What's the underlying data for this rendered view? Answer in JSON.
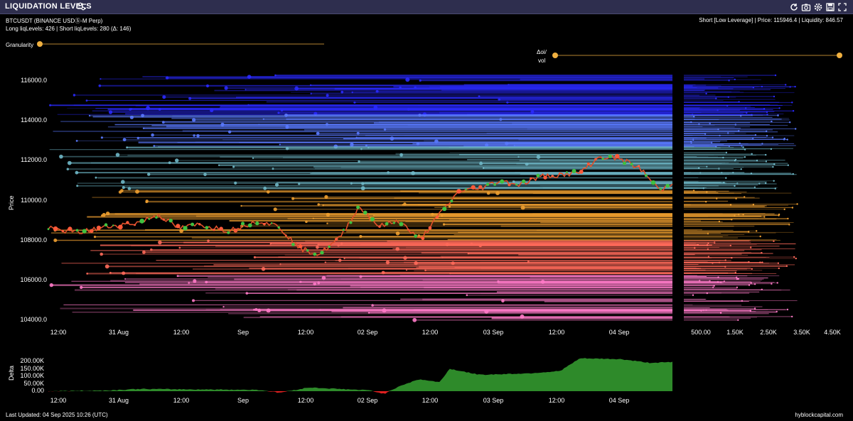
{
  "window": {
    "title": "LIQUIDATION LEVELS",
    "icons": [
      "refresh-icon",
      "camera-icon",
      "settings-icon",
      "save-icon",
      "expand-icon",
      "close-icon"
    ]
  },
  "header": {
    "symbol": "BTCUSDT (BINANCE USDⓈ-M Perp)",
    "levels_summary": "Long liqLevels: 426 | Short liqLevels: 280 (Δ: 146)",
    "selection_info": "Short [Low Leverage] | Price: 115946.4 | Liquidity: 846.57"
  },
  "controls": {
    "granularity_label": "Granularity",
    "granularity_value": 0.0,
    "delta_label_top": "Δoi/",
    "delta_label_bottom": "vol",
    "delta_value": 0.0,
    "accent": "#f0b040"
  },
  "footer": {
    "last_updated": "Last Updated: 04 Sep 2025 10:26 (UTC)",
    "brand": "hyblockcapital.com"
  },
  "chart_data": [
    {
      "type": "line",
      "title": "",
      "ylabel": "Price",
      "y_ticks": [
        "116000.0",
        "114000.0",
        "112000.0",
        "110000.0",
        "108000.0",
        "106000.0",
        "104000.0"
      ],
      "ylim": [
        103700,
        117000
      ],
      "x_ticks": [
        "12:00",
        "31 Aug",
        "12:00",
        "Sep",
        "12:00",
        "02 Sep",
        "12:00",
        "03 Sep",
        "12:00",
        "04 Sep"
      ],
      "x_start": "2025-08-30T06:00",
      "x_end": "2025-09-04T10:26",
      "price_series": [
        {
          "t": "2025-08-30T06:00",
          "p": 108600
        },
        {
          "t": "2025-08-30T12:00",
          "p": 108400
        },
        {
          "t": "2025-08-30T18:00",
          "p": 108700
        },
        {
          "t": "2025-08-31T00:00",
          "p": 108900
        },
        {
          "t": "2025-08-31T04:00",
          "p": 109300
        },
        {
          "t": "2025-08-31T08:00",
          "p": 108600
        },
        {
          "t": "2025-08-31T12:00",
          "p": 108800
        },
        {
          "t": "2025-08-31T18:00",
          "p": 108500
        },
        {
          "t": "2025-09-01T00:00",
          "p": 109000
        },
        {
          "t": "2025-09-01T04:00",
          "p": 108700
        },
        {
          "t": "2025-09-01T08:00",
          "p": 107600
        },
        {
          "t": "2025-09-01T12:00",
          "p": 107300
        },
        {
          "t": "2025-09-01T16:00",
          "p": 108100
        },
        {
          "t": "2025-09-01T20:00",
          "p": 109700
        },
        {
          "t": "2025-09-02T00:00",
          "p": 108700
        },
        {
          "t": "2025-09-02T04:00",
          "p": 109000
        },
        {
          "t": "2025-09-02T08:00",
          "p": 108000
        },
        {
          "t": "2025-09-02T12:00",
          "p": 109300
        },
        {
          "t": "2025-09-02T16:00",
          "p": 110500
        },
        {
          "t": "2025-09-02T20:00",
          "p": 110600
        },
        {
          "t": "2025-09-03T00:00",
          "p": 111000
        },
        {
          "t": "2025-09-03T04:00",
          "p": 110800
        },
        {
          "t": "2025-09-03T08:00",
          "p": 111200
        },
        {
          "t": "2025-09-03T12:00",
          "p": 111300
        },
        {
          "t": "2025-09-03T16:00",
          "p": 111400
        },
        {
          "t": "2025-09-03T20:00",
          "p": 112200
        },
        {
          "t": "2025-09-04T00:00",
          "p": 112100
        },
        {
          "t": "2025-09-04T04:00",
          "p": 111600
        },
        {
          "t": "2025-09-04T08:00",
          "p": 110500
        },
        {
          "t": "2025-09-04T10:26",
          "p": 110900
        }
      ],
      "liquidity_axis_ticks": [
        "500.00",
        "1.50K",
        "2.50K",
        "3.50K",
        "4.50K"
      ],
      "level_colors": {
        "short_high": "#2a2aff",
        "short_mid": "#5a7aff",
        "short_low": "#6fb8c8",
        "long_low": "#f0a030",
        "long_mid": "#ff6a5a",
        "long_high": "#ff7ac8"
      }
    },
    {
      "type": "area",
      "title": "",
      "ylabel": "Delta",
      "y_ticks": [
        "200.00K",
        "150.00K",
        "100.00K",
        "50.00K",
        "0.00"
      ],
      "ylim": [
        -30000,
        250000
      ],
      "x_ticks": [
        "12:00",
        "31 Aug",
        "12:00",
        "Sep",
        "12:00",
        "02 Sep",
        "12:00",
        "03 Sep",
        "12:00",
        "04 Sep"
      ],
      "series": [
        {
          "t": "2025-08-30T06:00",
          "v": 0
        },
        {
          "t": "2025-08-30T18:00",
          "v": 5000
        },
        {
          "t": "2025-08-31T00:00",
          "v": 15000
        },
        {
          "t": "2025-08-31T12:00",
          "v": 12000
        },
        {
          "t": "2025-09-01T00:00",
          "v": 9000
        },
        {
          "t": "2025-09-01T04:00",
          "v": -10000
        },
        {
          "t": "2025-09-01T10:00",
          "v": 25000
        },
        {
          "t": "2025-09-01T16:00",
          "v": 15000
        },
        {
          "t": "2025-09-01T22:00",
          "v": 6000
        },
        {
          "t": "2025-09-02T01:00",
          "v": -18000
        },
        {
          "t": "2025-09-02T04:00",
          "v": 35000
        },
        {
          "t": "2025-09-02T08:00",
          "v": 80000
        },
        {
          "t": "2025-09-02T12:00",
          "v": 60000
        },
        {
          "t": "2025-09-02T14:00",
          "v": 150000
        },
        {
          "t": "2025-09-02T20:00",
          "v": 110000
        },
        {
          "t": "2025-09-03T06:00",
          "v": 120000
        },
        {
          "t": "2025-09-03T12:00",
          "v": 135000
        },
        {
          "t": "2025-09-03T16:00",
          "v": 220000
        },
        {
          "t": "2025-09-04T00:00",
          "v": 215000
        },
        {
          "t": "2025-09-04T06:00",
          "v": 190000
        },
        {
          "t": "2025-09-04T10:26",
          "v": 195000
        }
      ],
      "positive_color": "#2e8a2a",
      "negative_color": "#e02020"
    }
  ]
}
